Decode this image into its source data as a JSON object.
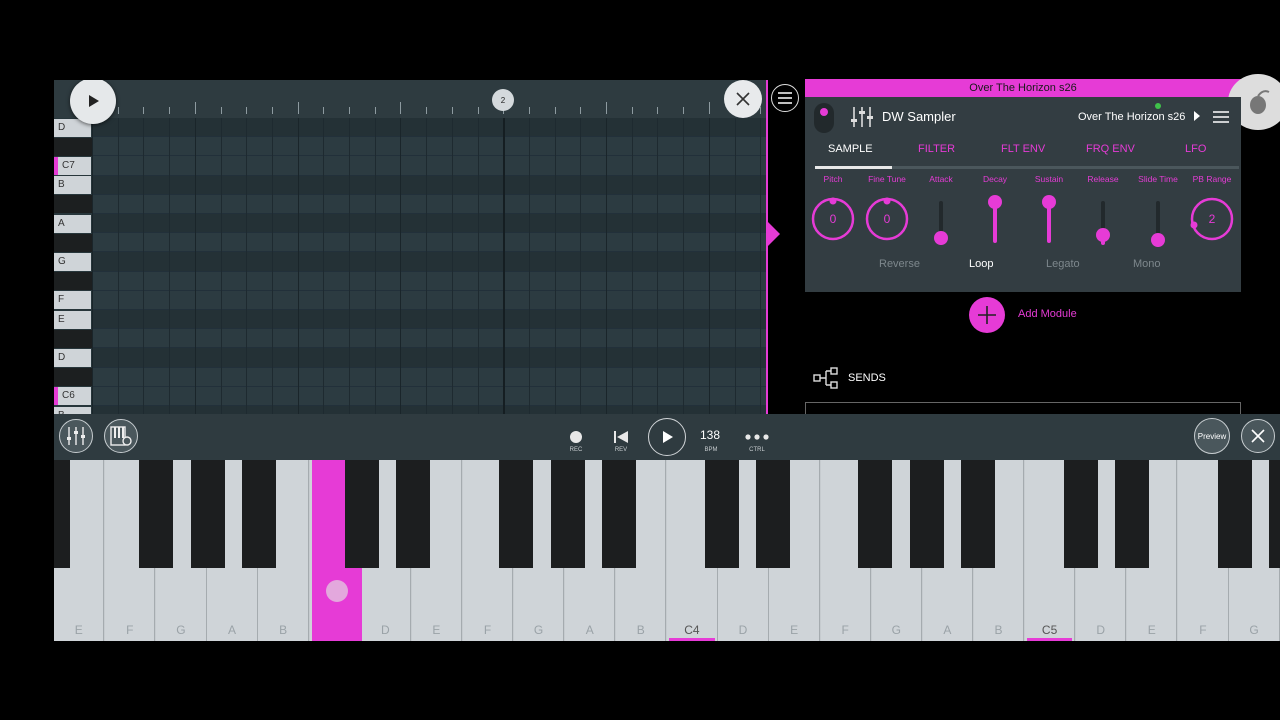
{
  "piano_roll": {
    "bar_marker": "2",
    "key_labels": [
      "D",
      "C7",
      "B",
      "A",
      "G",
      "F",
      "E",
      "D",
      "C6",
      "B"
    ]
  },
  "channel": {
    "title": "Over The Horizon s26",
    "instrument_name": "DW Sampler",
    "preset_name": "Over The Horizon s26",
    "tabs": [
      "SAMPLE",
      "FILTER",
      "FLT ENV",
      "FRQ ENV",
      "LFO"
    ],
    "active_tab": "SAMPLE",
    "params": {
      "pitch": {
        "label": "Pitch",
        "value": "0"
      },
      "fine_tune": {
        "label": "Fine Tune",
        "value": "0"
      },
      "attack": {
        "label": "Attack",
        "level": 0.0
      },
      "decay": {
        "label": "Decay",
        "level": 1.0
      },
      "sustain": {
        "label": "Sustain",
        "level": 1.0
      },
      "release": {
        "label": "Release",
        "level": 0.1
      },
      "slide_time": {
        "label": "Slide Time",
        "level": 0.0
      },
      "pb_range": {
        "label": "PB Range",
        "value": "2"
      }
    },
    "options": [
      {
        "label": "Reverse",
        "active": false
      },
      {
        "label": "Loop",
        "active": true
      },
      {
        "label": "Legato",
        "active": false
      },
      {
        "label": "Mono",
        "active": false
      }
    ],
    "add_module_label": "Add Module",
    "sends_label": "SENDS"
  },
  "transport": {
    "rec_label": "REC",
    "rev_label": "REV",
    "bpm_value": "138",
    "bpm_label": "BPM",
    "ctrl_label": "CTRL",
    "preview_label": "Preview"
  },
  "keyboard": {
    "white_keys": [
      {
        "label": "E"
      },
      {
        "label": "F"
      },
      {
        "label": "G"
      },
      {
        "label": "A"
      },
      {
        "label": "B"
      },
      {
        "label": ""
      },
      {
        "label": "D"
      },
      {
        "label": "E"
      },
      {
        "label": "F"
      },
      {
        "label": "G"
      },
      {
        "label": "A"
      },
      {
        "label": "B"
      },
      {
        "label": "C4"
      },
      {
        "label": "D"
      },
      {
        "label": "E"
      },
      {
        "label": "F"
      },
      {
        "label": "G"
      },
      {
        "label": "A"
      },
      {
        "label": "B"
      },
      {
        "label": "C5"
      },
      {
        "label": "D"
      },
      {
        "label": "E"
      },
      {
        "label": "F"
      },
      {
        "label": "G"
      }
    ]
  },
  "colors": {
    "accent": "#e63bd6",
    "panel": "#333d42",
    "roll_bg": "#27363b"
  }
}
